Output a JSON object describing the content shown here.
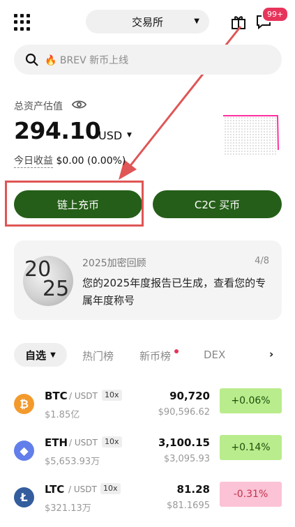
{
  "colors": {
    "brand_green": "#255e18",
    "up_bg": "#b9ec8c",
    "down_bg": "#fbc3d5",
    "badge_red": "#e7345b",
    "annotation_red": "#e05555"
  },
  "header": {
    "exchange_selector": "交易所",
    "notification_badge": "99+",
    "icons": [
      "grid-menu-icon",
      "gift-icon",
      "message-icon"
    ]
  },
  "search": {
    "placeholder_emoji": "🔥",
    "placeholder": "BREV 新币上线"
  },
  "assets": {
    "label": "总资产估值",
    "amount": "294.10",
    "currency": "USD",
    "today_label": "今日收益",
    "today_value": "$0.00 (0.00%)"
  },
  "actions": {
    "deposit_label": "链上充币",
    "c2c_label": "C2C 买币"
  },
  "review_card": {
    "year_top": "20",
    "year_bottom": "25",
    "title": "2025加密回顾",
    "page": "4/8",
    "text": "您的2025年度报告已生成，查看您的专属年度称号"
  },
  "tabs": {
    "selected": "自选",
    "items": [
      "热门榜",
      "新币榜",
      "DEX"
    ]
  },
  "market": [
    {
      "symbol": "BTC",
      "quote": "/ USDT",
      "leverage": "10x",
      "volume": "$1.85亿",
      "price": "90,720",
      "price_usd": "$90,596.62",
      "change": "+0.06%",
      "dir": "up",
      "icon": "bitcoin-icon",
      "icon_color": "#f39a2d",
      "glyph": "₿"
    },
    {
      "symbol": "ETH",
      "quote": "/ USDT",
      "leverage": "10x",
      "volume": "$5,653.93万",
      "price": "3,100.15",
      "price_usd": "$3,095.93",
      "change": "+0.14%",
      "dir": "up",
      "icon": "ethereum-icon",
      "icon_color": "#627eea",
      "glyph": "◆"
    },
    {
      "symbol": "LTC",
      "quote": "/ USDT",
      "leverage": "10x",
      "volume": "$321.13万",
      "price": "81.28",
      "price_usd": "$81.1695",
      "change": "-0.31%",
      "dir": "down",
      "icon": "litecoin-icon",
      "icon_color": "#345d9d",
      "glyph": "Ł"
    }
  ]
}
